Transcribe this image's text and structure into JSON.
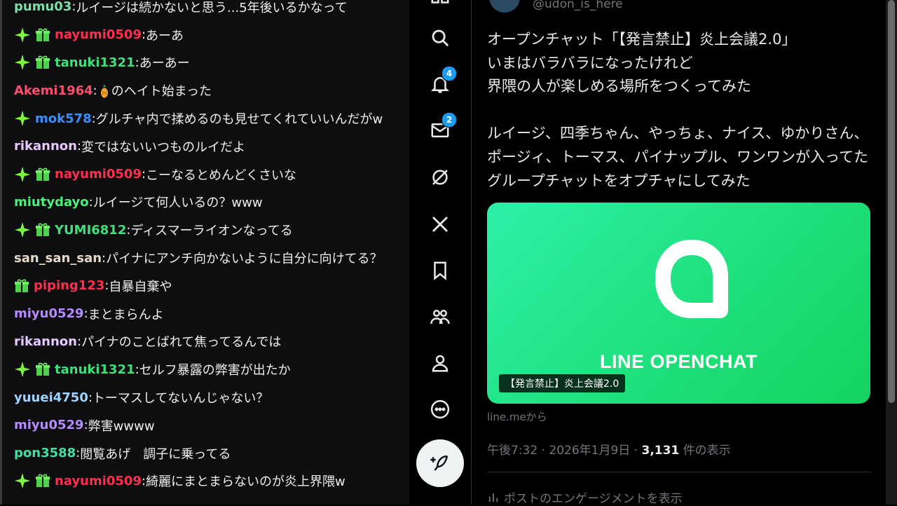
{
  "chat": {
    "messages": [
      {
        "user": "pumu03",
        "color": "#7ce0a6",
        "badges": [],
        "text": "ルイージは続かないと思う...5年後いるかなって"
      },
      {
        "user": "nayumi0509",
        "color": "#ff2e4d",
        "badges": [
          "sparkle",
          "gift"
        ],
        "text": "あーあ"
      },
      {
        "user": "tanuki1321",
        "color": "#3fe07c",
        "badges": [
          "sparkle",
          "gift"
        ],
        "text": "あーあー"
      },
      {
        "user": "Akemi1964",
        "color": "#ff4d6d",
        "badges": [],
        "emote": "pineapple",
        "text": "のヘイト始まった"
      },
      {
        "user": "mok578",
        "color": "#3a8fff",
        "badges": [
          "sparkle"
        ],
        "text": "グルチャ内で揉めるのも見せてくれていいんだがw"
      },
      {
        "user": "rikannon",
        "color": "#e8c8ff",
        "badges": [],
        "text": "変ではないいつものルイだよ"
      },
      {
        "user": "nayumi0509",
        "color": "#ff2e4d",
        "badges": [
          "sparkle",
          "gift"
        ],
        "text": "こーなるとめんどくさいな"
      },
      {
        "user": "miutydayo",
        "color": "#4df07a",
        "badges": [],
        "text": "ルイージて何人いるの？www"
      },
      {
        "user": "YUMI6812",
        "color": "#3fe07c",
        "badges": [
          "sparkle",
          "gift"
        ],
        "text": "ディスマーライオンなってる"
      },
      {
        "user": "san_san_san",
        "color": "#e6d9c8",
        "badges": [],
        "text": "パイナにアンチ向かないように自分に向けてる？"
      },
      {
        "user": "piping123",
        "color": "#ff2e4d",
        "badges": [
          "gift"
        ],
        "text": "自暴自棄や"
      },
      {
        "user": "miyu0529",
        "color": "#b58cff",
        "badges": [],
        "text": "まとまらんよ"
      },
      {
        "user": "rikannon",
        "color": "#e8c8ff",
        "badges": [],
        "text": "パイナのことばれて焦ってるんでは"
      },
      {
        "user": "tanuki1321",
        "color": "#3fe07c",
        "badges": [
          "sparkle",
          "gift"
        ],
        "text": "セルフ暴露の弊害が出たか"
      },
      {
        "user": "yuuei4750",
        "color": "#9fd3ff",
        "badges": [],
        "text": "トーマスしてないんじゃない？"
      },
      {
        "user": "miyu0529",
        "color": "#b58cff",
        "badges": [],
        "text": "弊害wwww"
      },
      {
        "user": "pon3588",
        "color": "#3fe0a0",
        "badges": [],
        "text": "閲覧あげ　調子に乗ってる"
      },
      {
        "user": "nayumi0509",
        "color": "#ff2e4d",
        "badges": [
          "sparkle",
          "gift"
        ],
        "text": "綺麗にまとまらないのが炎上界隈w"
      }
    ]
  },
  "nav": {
    "notifications_count": "4",
    "messages_count": "2",
    "items": [
      "home-icon",
      "search-icon",
      "bell-icon",
      "mail-icon",
      "grok-icon",
      "x-logo-icon",
      "bookmark-icon",
      "communities-icon",
      "profile-icon",
      "more-icon"
    ]
  },
  "post": {
    "handle": "@udon_is_here",
    "text": "オープンチャット「【発言禁止】炎上会議2.0」\nいまはバラバラになったけれど\n界隈の人が楽しめる場所をつくってみた\n\nルイージ、四季ちゃん、やっちょ、ナイス、ゆかりさん、ポージィ、トーマス、パイナップル、ワンワンが入ってたグループチャットをオプチャにしてみた",
    "card": {
      "brand": "LINE OPENCHAT",
      "caption": "【発言禁止】炎上会議2.0",
      "domain": "line.meから"
    },
    "meta": {
      "time": "午後7:32 · 2026年1月9日 · ",
      "views": "3,131",
      "views_suffix": " 件の表示"
    },
    "engagement": "ポストのエンゲージメントを表示"
  },
  "colors": {
    "chat_bg": "#0e0e10",
    "accent_blue": "#1d9bf0",
    "card_green": "#1ee07c"
  }
}
